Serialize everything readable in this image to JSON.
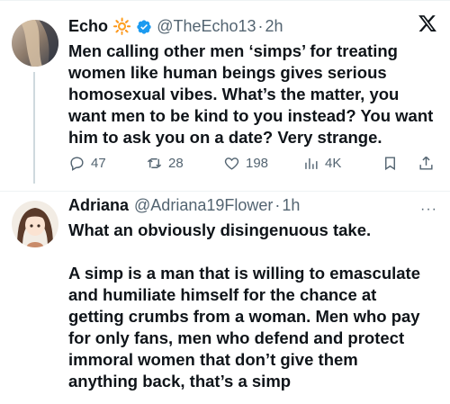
{
  "tweet1": {
    "name": "Echo",
    "emoji": "🔆",
    "handle": "@TheEcho13",
    "dot": "·",
    "time": "2h",
    "text_lines": [
      "Men calling other men ‘simps’ for treating",
      "women like human beings gives serious",
      "homosexual vibes. What’s the matter, you",
      "want men to be kind to you instead? You want",
      "him to ask you on a date? Very strange."
    ],
    "stats": {
      "replies": "47",
      "retweets": "28",
      "likes": "198",
      "views": "4K"
    }
  },
  "tweet2": {
    "name": "Adriana",
    "handle": "@Adriana19Flower",
    "dot": "·",
    "time": "1h",
    "text_lines": [
      "What an obviously disingenuous take.",
      "",
      "A simp is a man that is willing to emasculate",
      "and humiliate himself for the chance at",
      "getting crumbs from a woman. Men who pay",
      "for only fans, men who defend and protect",
      "immoral women that don’t give them",
      "anything back, that’s a simp"
    ],
    "more": "···"
  },
  "colors": {
    "verified": "#1d9bf0",
    "muted": "#536471",
    "text": "#0f1419"
  },
  "icons": [
    "x-logo-icon",
    "verified-badge-icon",
    "reply-icon",
    "retweet-icon",
    "like-icon",
    "views-icon",
    "bookmark-icon",
    "share-icon",
    "more-icon"
  ]
}
